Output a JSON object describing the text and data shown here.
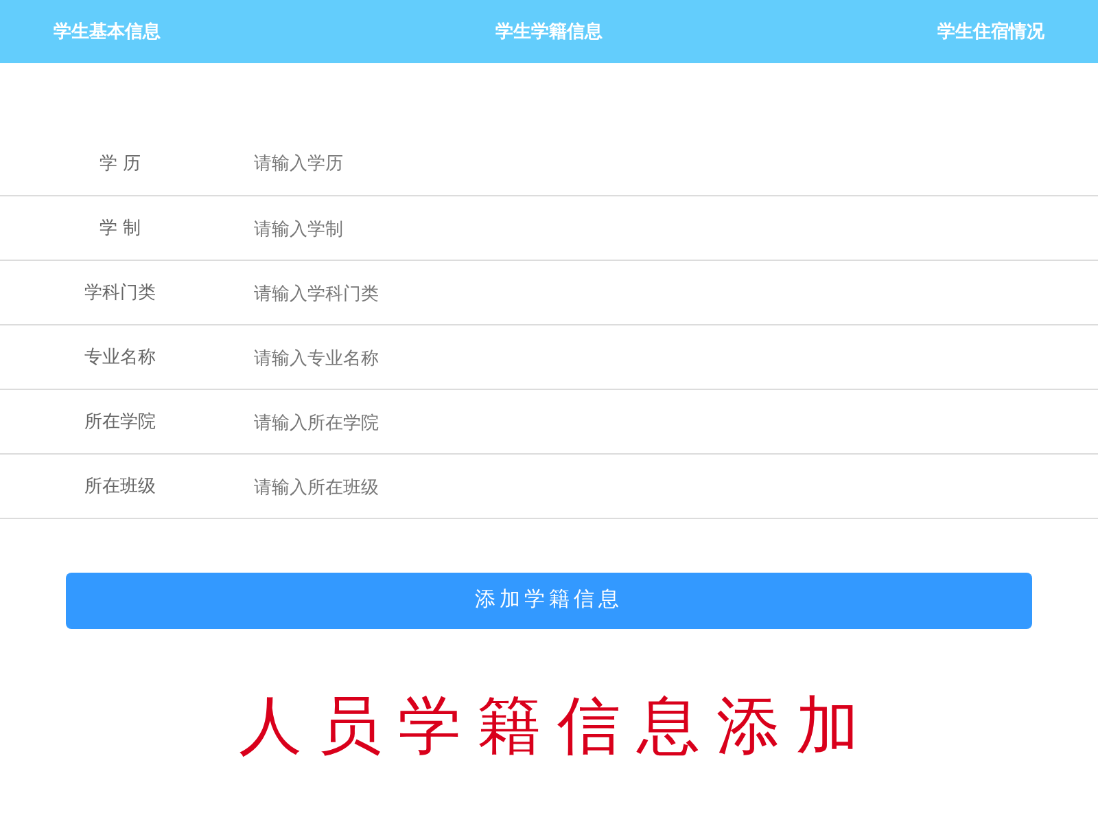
{
  "nav": {
    "tabs": [
      {
        "label": "学生基本信息"
      },
      {
        "label": "学生学籍信息"
      },
      {
        "label": "学生住宿情况"
      }
    ]
  },
  "form": {
    "fields": [
      {
        "label": "学 历",
        "placeholder": "请输入学历"
      },
      {
        "label": "学 制",
        "placeholder": "请输入学制"
      },
      {
        "label": "学科门类",
        "placeholder": "请输入学科门类"
      },
      {
        "label": "专业名称",
        "placeholder": "请输入专业名称"
      },
      {
        "label": "所在学院",
        "placeholder": "请输入所在学院"
      },
      {
        "label": "所在班级",
        "placeholder": "请输入所在班级"
      }
    ]
  },
  "submit_button": "添加学籍信息",
  "caption": "人员学籍信息添加"
}
